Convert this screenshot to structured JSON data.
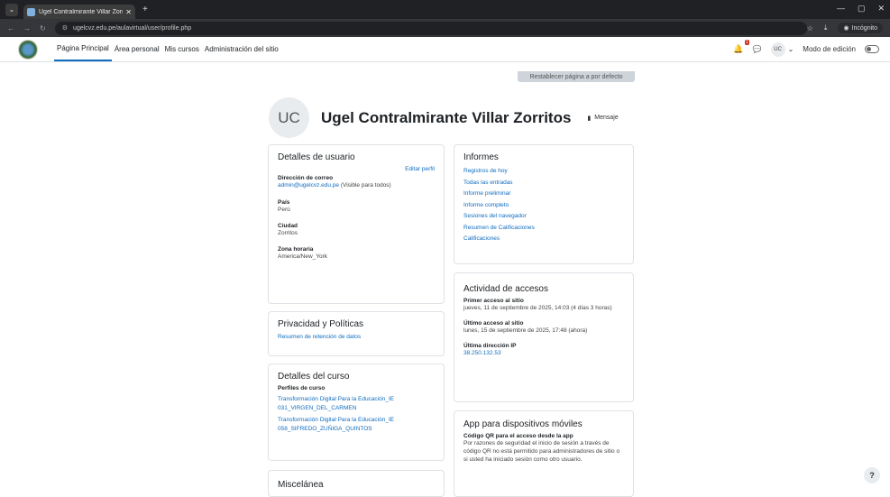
{
  "browser": {
    "tab_title": "Ugel Contralmirante Villar Zorri",
    "url": "ugelcvz.edu.pe/aulavirtual/user/profile.php",
    "incognito_label": "Incógnito"
  },
  "nav": {
    "items": [
      "Página Principal",
      "Área personal",
      "Mis cursos",
      "Administración del sitio"
    ],
    "avatar": "UC",
    "edit_mode": "Modo de edición",
    "badge": "1"
  },
  "reset_button": "Restablecer página a por defecto",
  "profile": {
    "initials": "UC",
    "name": "Ugel Contralmirante Villar Zorritos",
    "message": "Mensaje"
  },
  "user_details": {
    "title": "Detalles de usuario",
    "edit": "Editar perfil",
    "email_label": "Dirección de correo",
    "email": "admin@ugelcvz.edu.pe",
    "email_note": "(Visible para todos)",
    "country_label": "País",
    "country": "Perú",
    "city_label": "Ciudad",
    "city": "Zorritos",
    "tz_label": "Zona horaria",
    "tz": "America/New_York"
  },
  "privacy": {
    "title": "Privacidad y Políticas",
    "link": "Resumen de retención de datos"
  },
  "course_details": {
    "title": "Detalles del curso",
    "label": "Perfiles de curso",
    "courses": [
      "Transformación Digital Para la Educación_IE 031_VIRGEN_DEL_CARMEN",
      "Transformación Digital Para la Educación_IE 058_SIFREDO_ZUÑIGA_QUINTOS"
    ]
  },
  "misc": {
    "title": "Miscelánea"
  },
  "reports": {
    "title": "Informes",
    "links": [
      "Registros de hoy",
      "Todas las entradas",
      "Informe preliminar",
      "Informe completo",
      "Sesiones del navegador",
      "Resumen de Calificaciones",
      "Calificaciones"
    ]
  },
  "access": {
    "title": "Actividad de accesos",
    "first_label": "Primer acceso al sitio",
    "first": "jueves, 11 de septiembre de 2025, 14:03  (4 días 3 horas)",
    "last_label": "Último acceso al sitio",
    "last": "lunes, 15 de septiembre de 2025, 17:48  (ahora)",
    "ip_label": "Última dirección IP",
    "ip": "38.250.132.53"
  },
  "app": {
    "title": "App para dispositivos móviles",
    "label": "Código QR para el acceso desde la app",
    "text": "Por razones de seguridad el inicio de sesión a través de código QR no está permitido para administradores de sitio o si usted ha iniciado sesión como otro usuario."
  }
}
